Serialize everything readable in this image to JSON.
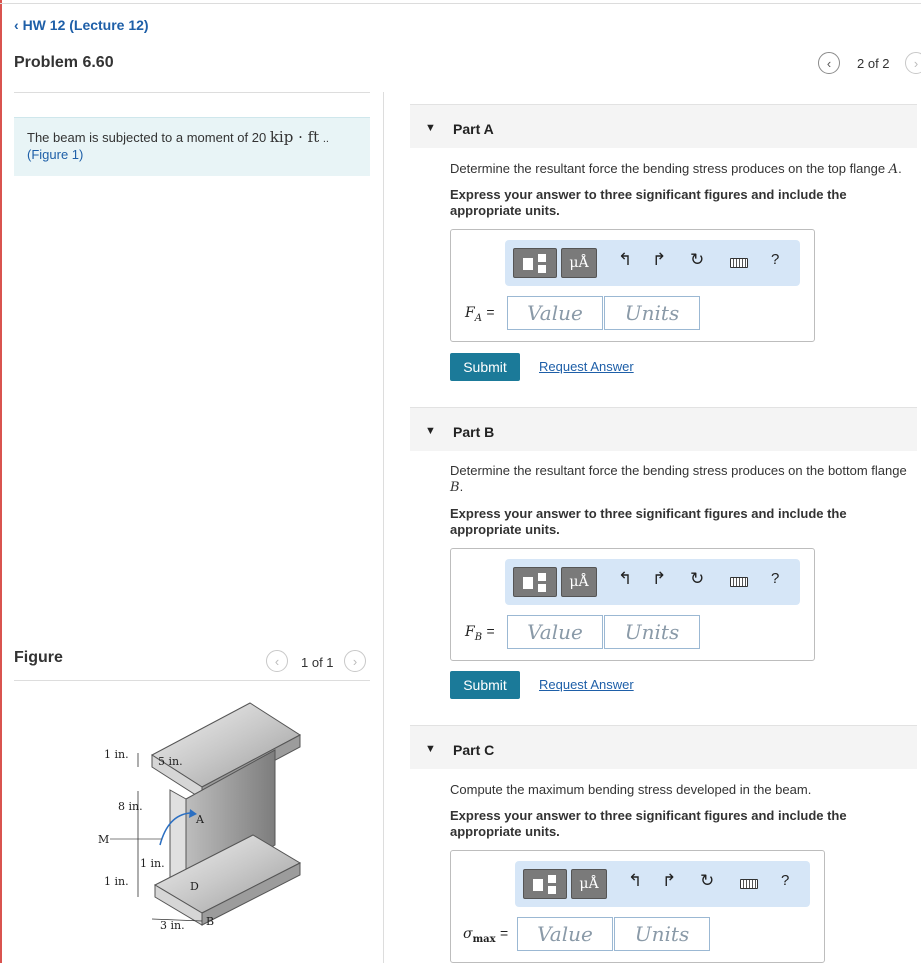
{
  "header": {
    "back_label": "HW 12 (Lecture 12)",
    "problem_title": "Problem 6.60",
    "pager": "2 of 2"
  },
  "intro": {
    "text": "The beam is subjected to a moment of 20",
    "moment_units": "kip · ft",
    "ellipsis": "..",
    "figure_link": "(Figure 1)"
  },
  "figure": {
    "label": "Figure",
    "pager": "1 of 1",
    "dimensions": {
      "top_thickness": "1 in.",
      "flange_width": "5 in.",
      "web_height": "8 in.",
      "moment_label": "M",
      "web_thickness": "1 in.",
      "bottom_thickness": "1 in.",
      "bottom_width": "3 in.",
      "point_a": "A",
      "point_b": "B",
      "point_d": "D"
    }
  },
  "toolbar": {
    "units_btn": "μÅ",
    "help": "?"
  },
  "parts": [
    {
      "title": "Part A",
      "question": "Determine the resultant force the bending stress produces on the top flange",
      "question_var": "A",
      "instruction": "Express your answer to three significant figures and include the appropriate units.",
      "eq_var": "F",
      "eq_sub": "A",
      "value_placeholder": "Value",
      "units_placeholder": "Units",
      "submit": "Submit",
      "request": "Request Answer"
    },
    {
      "title": "Part B",
      "question": "Determine the resultant force the bending stress produces on the bottom flange",
      "question_var": "B",
      "instruction": "Express your answer to three significant figures and include the appropriate units.",
      "eq_var": "F",
      "eq_sub": "B",
      "value_placeholder": "Value",
      "units_placeholder": "Units",
      "submit": "Submit",
      "request": "Request Answer"
    },
    {
      "title": "Part C",
      "question": "Compute the maximum bending stress developed in the beam.",
      "instruction": "Express your answer to three significant figures and include the appropriate units.",
      "eq_var": "σ",
      "eq_sub": "max",
      "value_placeholder": "Value",
      "units_placeholder": "Units"
    }
  ]
}
